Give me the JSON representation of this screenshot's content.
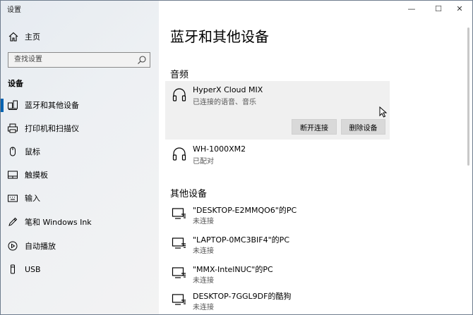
{
  "window": {
    "title": "设置",
    "minimize_symbol": "—",
    "maximize_symbol": "☐",
    "close_symbol": "✕"
  },
  "sidebar": {
    "home_label": "主页",
    "search_placeholder": "查找设置",
    "section_label": "设备",
    "items": [
      {
        "label": "蓝牙和其他设备",
        "icon": "bluetooth-devices-icon",
        "active": true
      },
      {
        "label": "打印机和扫描仪",
        "icon": "printer-icon"
      },
      {
        "label": "鼠标",
        "icon": "mouse-icon"
      },
      {
        "label": "触摸板",
        "icon": "touchpad-icon"
      },
      {
        "label": "输入",
        "icon": "keyboard-icon"
      },
      {
        "label": "笔和 Windows Ink",
        "icon": "pen-icon"
      },
      {
        "label": "自动播放",
        "icon": "autoplay-icon"
      },
      {
        "label": "USB",
        "icon": "usb-icon"
      }
    ]
  },
  "main": {
    "title": "蓝牙和其他设备",
    "audio_section": {
      "heading": "音频",
      "devices": [
        {
          "name": "HyperX Cloud MIX",
          "status": "已连接的语音、音乐",
          "icon": "headphones-icon",
          "selected": true
        },
        {
          "name": "WH-1000XM2",
          "status": "已配对",
          "icon": "headphones-icon"
        }
      ],
      "disconnect_label": "断开连接",
      "remove_label": "删除设备"
    },
    "other_section": {
      "heading": "其他设备",
      "devices": [
        {
          "name": "\"DESKTOP-E2MMQO6\"的PC",
          "status": "未连接",
          "icon": "network-pc-icon"
        },
        {
          "name": "\"LAPTOP-0MC3BIF4\"的PC",
          "status": "未连接",
          "icon": "network-pc-icon"
        },
        {
          "name": "\"MMX-IntelNUC\"的PC",
          "status": "未连接",
          "icon": "network-pc-icon"
        },
        {
          "name": "DESKTOP-7GGL9DF的酷狗",
          "status": "未连接",
          "icon": "network-pc-icon"
        }
      ]
    }
  },
  "colors": {
    "accent": "#0063b1",
    "sidebar_bg": "#eceff2",
    "selected_bg": "#f0f0f0",
    "button_bg": "#d9d9d9"
  }
}
